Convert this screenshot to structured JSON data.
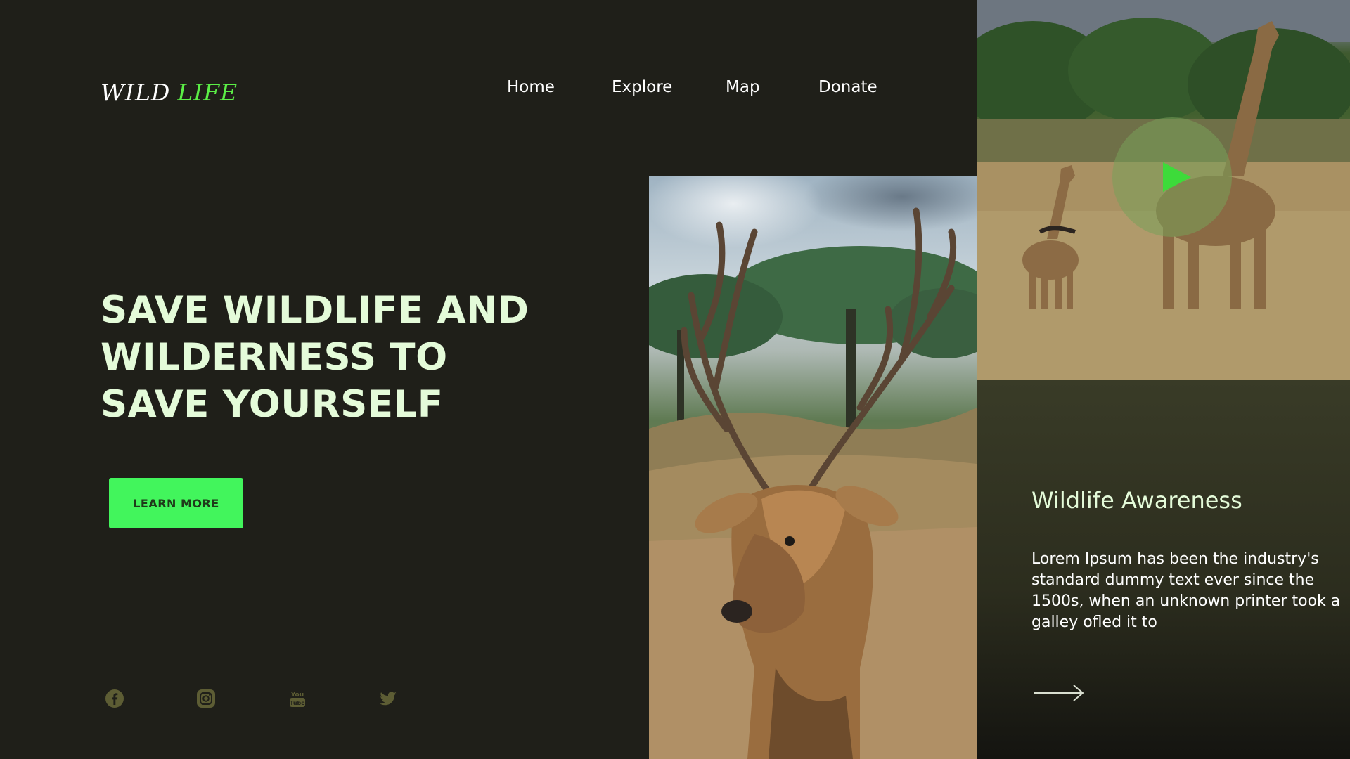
{
  "brand": {
    "logo_primary": "WILD",
    "logo_accent": "LIFE",
    "accent_color": "#5bef46"
  },
  "nav": {
    "items": [
      {
        "label": "Home"
      },
      {
        "label": "Explore"
      },
      {
        "label": "Map"
      },
      {
        "label": "Donate"
      }
    ]
  },
  "hero": {
    "title_lines": [
      "SAVE WILDLIFE AND",
      "WILDERNESS TO",
      "SAVE YOURSELF"
    ],
    "cta_label": "LEARN MORE",
    "cta_color": "#42f55c"
  },
  "social": {
    "icons": [
      "facebook-icon",
      "instagram-icon",
      "youtube-icon",
      "twitter-icon"
    ],
    "icon_color": "#5d5d34"
  },
  "media": {
    "deer_image": "deer-photo",
    "giraffe_image": "giraffe-photo",
    "play_icon": "play-icon"
  },
  "info_card": {
    "title": "Wildlife Awareness",
    "body": "Lorem Ipsum has been the industry's standard dummy text ever since the 1500s, when an unknown printer took a galley ofled it to",
    "arrow_icon": "arrow-right-icon"
  },
  "colors": {
    "background": "#1f1f19",
    "heading": "#e4fbd9"
  }
}
